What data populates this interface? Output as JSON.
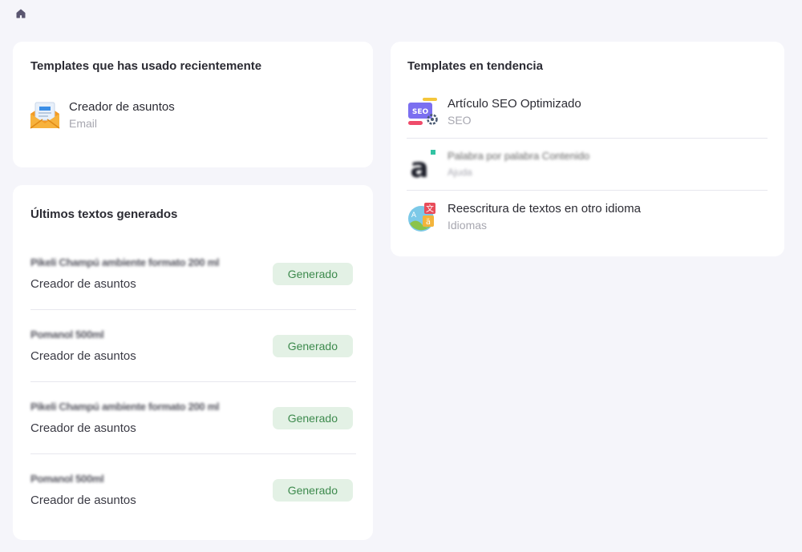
{
  "nav": {
    "home_icon": "home-icon"
  },
  "recent": {
    "title": "Templates que has usado recientemente",
    "items": [
      {
        "name": "Creador de asuntos",
        "category": "Email",
        "icon": "email-envelope-icon"
      }
    ]
  },
  "generated": {
    "title": "Últimos textos generados",
    "items": [
      {
        "title": "Pikeli Champú ambiente formato 200 ml",
        "template": "Creador de asuntos",
        "status": "Generado"
      },
      {
        "title": "Pomanol 500ml",
        "template": "Creador de asuntos",
        "status": "Generado"
      },
      {
        "title": "Pikeli Champú ambiente formato 200 ml",
        "template": "Creador de asuntos",
        "status": "Generado"
      },
      {
        "title": "Pomanol 500ml",
        "template": "Creador de asuntos",
        "status": "Generado"
      }
    ]
  },
  "trending": {
    "title": "Templates en tendencia",
    "items": [
      {
        "name": "Artículo SEO Optimizado",
        "category": "SEO",
        "icon": "seo-icon"
      },
      {
        "name": "Palabra por palabra Contenido",
        "category": "Ajuda",
        "icon": "letter-a-icon"
      },
      {
        "name": "Reescritura de textos en otro idioma",
        "category": "Idiomas",
        "icon": "translate-icon"
      }
    ]
  },
  "colors": {
    "background": "#f5f5fa",
    "card": "#ffffff",
    "badge_bg": "#e3f1e5",
    "badge_text": "#3d8a4d",
    "muted": "#a7a7b0"
  }
}
